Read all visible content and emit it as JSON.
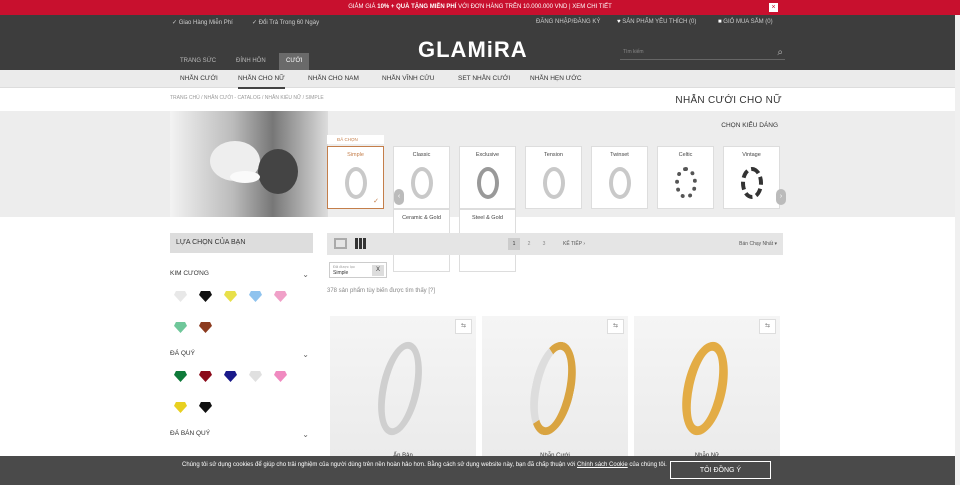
{
  "promo": {
    "pre": "GIẢM GIÁ ",
    "b1": "10% + QUÀ TẶNG MIỄN PHÍ",
    "post": " VỚI ĐƠN HÀNG TRÊN 10.000.000 VND | XEM CHI TIẾT",
    "close": "×"
  },
  "header": {
    "usp1": "Giao Hàng Miễn Phí",
    "usp2": "Đổi Trả Trong 60 Ngày",
    "login": "ĐĂNG NHẬP/ĐĂNG KÝ",
    "wishlist": "SẢN PHẨM YÊU THÍCH (0)",
    "cart": "GIỎ MUA SẮM (0)",
    "tab1": "TRANG SỨC",
    "tab2": "ĐÍNH HÔN",
    "tab3": "CƯỚI",
    "logo": "GLAMiRA",
    "search_placeholder": "Tìm kiếm"
  },
  "nav": [
    "NHẪN CƯỚI",
    "NHẪN CHO NỮ",
    "NHẪN CHO NAM",
    "NHẪN VĨNH CỬU",
    "SET NHẪN CƯỚI",
    "NHẪN HẸN ƯỚC"
  ],
  "breadcrumb": "TRANG CHỦ / NHẪN CƯỚI - CATALOG / NHẪN KIỂU NỮ / SIMPLE",
  "page_title": "NHẪN CƯỚI CHO NỮ",
  "style_picker": {
    "label": "CHỌN KIỂU DÁNG",
    "selected_badge": "ĐÃ CHỌN",
    "styles": [
      "Simple",
      "Classic",
      "Exclusive",
      "Tension",
      "Twinset",
      "Celtic",
      "Vintage",
      "Ceramic & Gold",
      "Steel & Gold"
    ]
  },
  "filters": {
    "header": "LỰA CHỌN CỦA BẠN",
    "g1": "KIM CƯƠNG",
    "g2": "ĐÁ QUÝ",
    "g3": "ĐÁ BÁN QUÝ",
    "colors_kc": [
      "#e8e8e8",
      "#111111",
      "#e8e04a",
      "#8fc3ee",
      "#f0a0c8",
      "#6fc79a",
      "#8b3a1e"
    ],
    "colors_dq": [
      "#0f7a3a",
      "#8b0a1a",
      "#1a1a8a",
      "#e0e0e0",
      "#f08ac0",
      "#e8d020",
      "#111111"
    ]
  },
  "toolbar": {
    "pages": [
      "1",
      "2",
      "3"
    ],
    "next": "KẾ TIẾP",
    "sort": "Bán Chạy Nhất"
  },
  "chip": {
    "label": "Đã được lọc",
    "value": "Simple",
    "remove": "X"
  },
  "count": "378 sản phẩm tùy biến được tìm thấy   [?]",
  "products": [
    {
      "name": "Ấn Bản"
    },
    {
      "name": "Nhẫn Cưới"
    },
    {
      "name": "Nhẫn Nữ"
    }
  ],
  "cookie": {
    "text": "Chúng tôi sử dụng cookies để giúp cho trải nghiệm của người dùng trên nền hoàn hảo hơn. Bằng cách sử dụng website này, bạn đã chấp thuận với ",
    "link": "Chính sách Cookie",
    "tail": " của chúng tôi.",
    "btn": "TÔI ĐỒNG Ý"
  }
}
